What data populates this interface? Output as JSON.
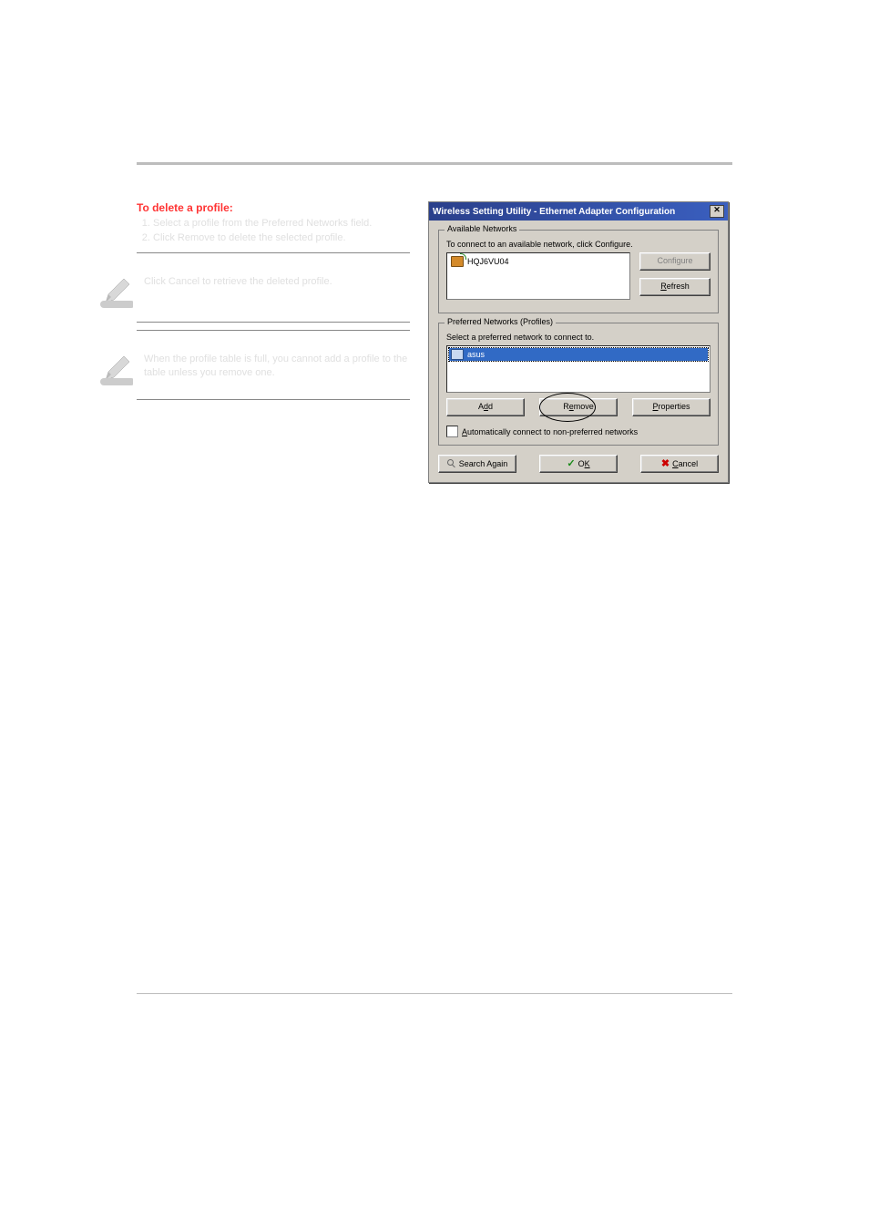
{
  "page": {
    "delete_heading": "To delete a profile:",
    "steps": [
      "Select a profile from the Preferred Networks field.",
      "Click Remove to delete the selected profile."
    ],
    "note1": "Click Cancel to retrieve the deleted profile.",
    "note2": "When the profile table is full, you cannot add a profile to the table unless you remove one."
  },
  "dialog": {
    "title": "Wireless Setting Utility - Ethernet Adapter Configuration",
    "available_group": {
      "legend": "Available Networks",
      "hint": "To connect to an available network, click Configure.",
      "item": "HQJ6VU04",
      "configure_btn": "Configure",
      "refresh_btn": "Refresh"
    },
    "preferred_group": {
      "legend": "Preferred Networks (Profiles)",
      "hint": "Select a preferred network to connect to.",
      "item": "asus",
      "add_btn": "Add",
      "remove_btn": "Remove",
      "properties_btn": "Properties",
      "checkbox_label": "Automatically connect to non-preferred networks"
    },
    "bottom": {
      "search_again": "Search Again",
      "ok": "OK",
      "cancel": "Cancel"
    }
  }
}
